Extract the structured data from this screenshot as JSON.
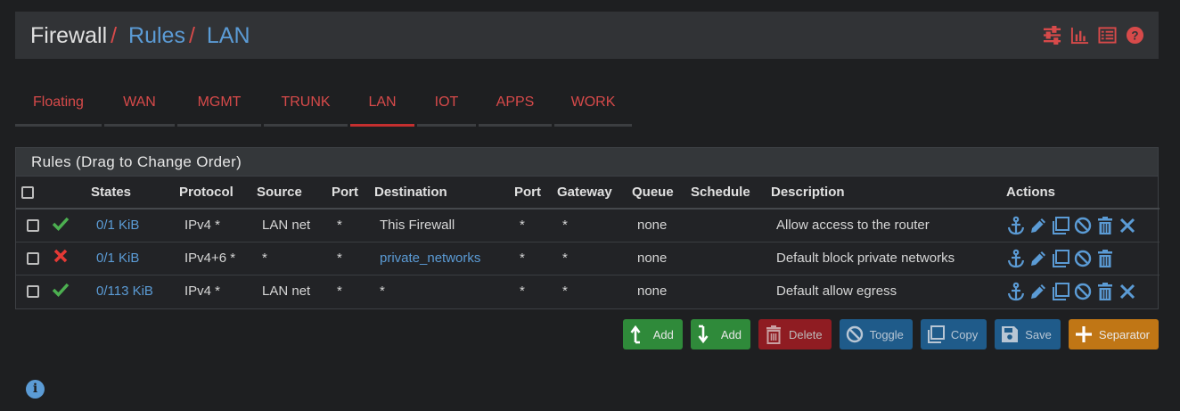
{
  "breadcrumb": {
    "root": "Firewall",
    "sep": "/",
    "items": [
      "Rules",
      "LAN"
    ]
  },
  "header_icons": [
    "sliders-icon",
    "bar-chart-icon",
    "list-icon",
    "help-icon"
  ],
  "tabs": [
    {
      "label": "Floating"
    },
    {
      "label": "WAN"
    },
    {
      "label": "MGMT"
    },
    {
      "label": "TRUNK"
    },
    {
      "label": "LAN",
      "active": true
    },
    {
      "label": "IOT"
    },
    {
      "label": "APPS"
    },
    {
      "label": "WORK"
    }
  ],
  "panel": {
    "title": "Rules (Drag to Change Order)",
    "columns": [
      "States",
      "Protocol",
      "Source",
      "Port",
      "Destination",
      "Port",
      "Gateway",
      "Queue",
      "Schedule",
      "Description",
      "Actions"
    ],
    "rows": [
      {
        "status": "pass",
        "states": "0/1 KiB",
        "protocol": "IPv4 *",
        "source": "LAN net",
        "sport": "*",
        "destination": "This Firewall",
        "dest_link": false,
        "dport": "*",
        "gateway": "*",
        "queue": "none",
        "schedule": "",
        "description": "Allow access to the router",
        "deletable": true
      },
      {
        "status": "block",
        "states": "0/1 KiB",
        "protocol": "IPv4+6 *",
        "source": "*",
        "sport": "*",
        "destination": "private_networks",
        "dest_link": true,
        "dport": "*",
        "gateway": "*",
        "queue": "none",
        "schedule": "",
        "description": "Default block private networks",
        "deletable": false
      },
      {
        "status": "pass",
        "states": "0/113 KiB",
        "protocol": "IPv4 *",
        "source": "LAN net",
        "sport": "*",
        "destination": "*",
        "dest_link": false,
        "dport": "*",
        "gateway": "*",
        "queue": "none",
        "schedule": "",
        "description": "Default allow egress",
        "deletable": true
      }
    ]
  },
  "buttons": {
    "add_top": "Add",
    "add_bottom": "Add",
    "delete": "Delete",
    "toggle": "Toggle",
    "copy": "Copy",
    "save": "Save",
    "separator": "Separator"
  },
  "info_icon": "i",
  "colors": {
    "accent_red": "#d74a4a",
    "link_blue": "#5b9bd5",
    "pass_green": "#4caf50",
    "block_red": "#e53935"
  }
}
